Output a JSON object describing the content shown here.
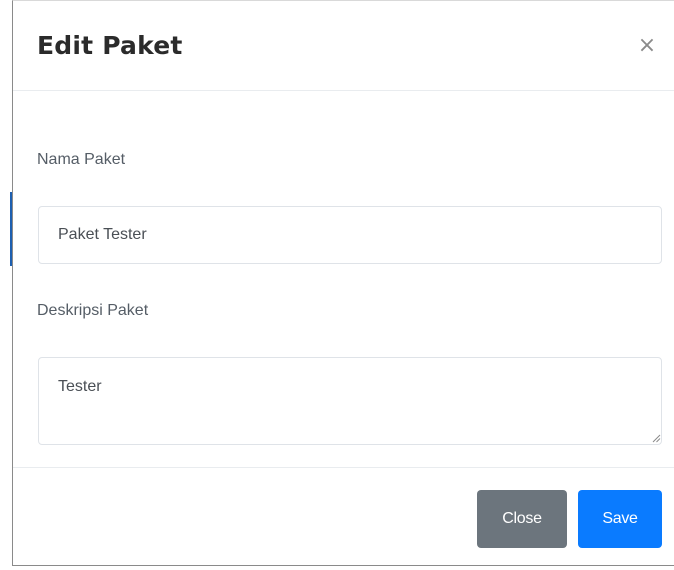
{
  "modal": {
    "title": "Edit Paket",
    "close_icon": "close-icon",
    "close_glyph": "×"
  },
  "form": {
    "name_label": "Nama Paket",
    "name_value": "Paket Tester",
    "description_label": "Deskripsi Paket",
    "description_value": "Tester"
  },
  "footer": {
    "close_label": "Close",
    "save_label": "Save"
  },
  "colors": {
    "close_button": "#6c757d",
    "save_button": "#0a7bff",
    "backdrop_accent": "#1d5fb0"
  }
}
